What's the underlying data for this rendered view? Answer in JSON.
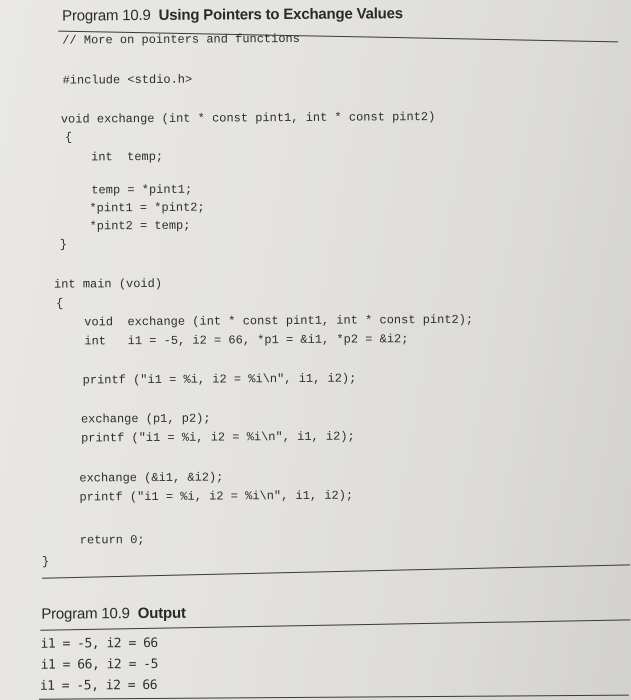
{
  "program": {
    "label": "Program 10.9",
    "title": "Using Pointers to Exchange Values"
  },
  "code": {
    "comment": "// More on pointers and functions",
    "include": "#include <stdio.h>",
    "func_sig": "void exchange (int * const pint1, int * const pint2)",
    "open_brace_1": "{",
    "decl_temp": "int  temp;",
    "stmt_1": "temp = *pint1;",
    "stmt_2": "*pint1 = *pint2;",
    "stmt_3": "*pint2 = temp;",
    "close_brace_1": "}",
    "main_sig": "int main (void)",
    "open_brace_2": "{",
    "proto": "void  exchange (int * const pint1, int * const pint2);",
    "decl_vars": "int   i1 = -5, i2 = 66, *p1 = &i1, *p2 = &i2;",
    "printf_1": "printf (\"i1 = %i, i2 = %i\\n\", i1, i2);",
    "call_1": "exchange (p1, p2);",
    "printf_2": "printf (\"i1 = %i, i2 = %i\\n\", i1, i2);",
    "call_2": "exchange (&i1, &i2);",
    "printf_3": "printf (\"i1 = %i, i2 = %i\\n\", i1, i2);",
    "return": "return 0;",
    "close_brace_2": "}"
  },
  "output": {
    "label": "Program 10.9",
    "title": "Output",
    "lines": [
      "i1 = -5, i2 = 66",
      "i1 = 66, i2 = -5",
      "i1 = -5, i2 = 66"
    ]
  }
}
